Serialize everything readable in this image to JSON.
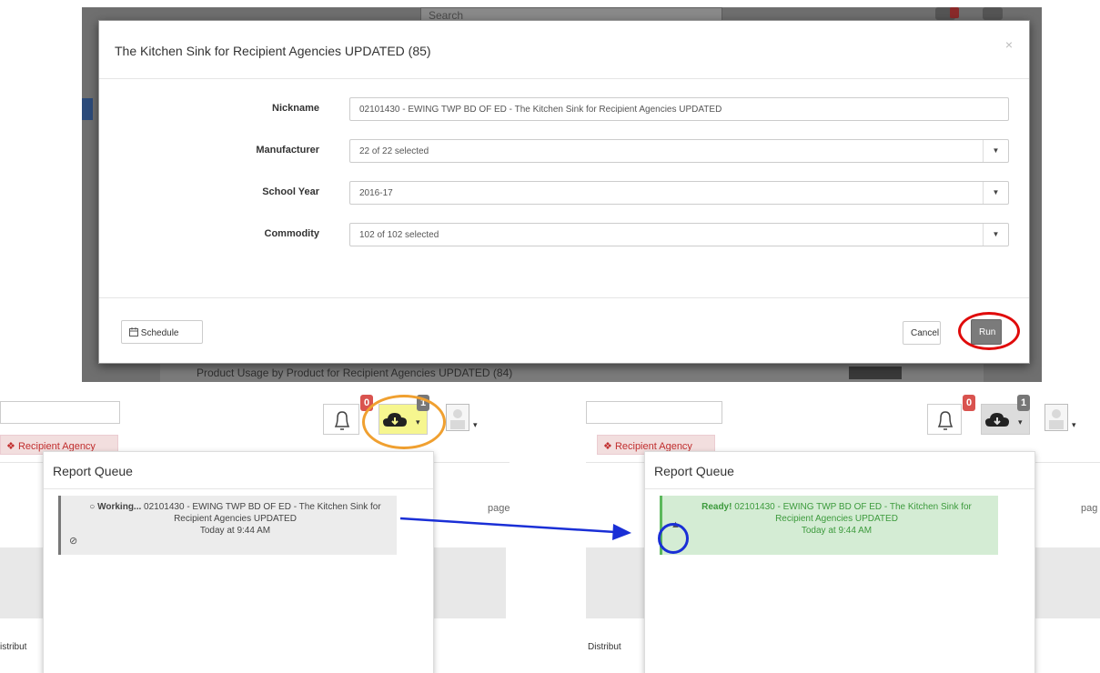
{
  "top": {
    "background": {
      "search_placeholder": "Search",
      "row_label": "Product Usage by Product for Recipient Agencies UPDATED (84)"
    },
    "modal": {
      "title": "The Kitchen Sink for Recipient Agencies UPDATED (85)",
      "close_icon": "×",
      "fields": {
        "nickname": {
          "label": "Nickname",
          "value": "02101430 - EWING TWP BD OF ED - The Kitchen Sink for Recipient Agencies UPDATED"
        },
        "manufacturer": {
          "label": "Manufacturer",
          "value": "22 of 22 selected"
        },
        "school_year": {
          "label": "School Year",
          "value": "2016-17"
        },
        "commodity": {
          "label": "Commodity",
          "value": "102 of 102 selected"
        }
      },
      "caret": "▼",
      "schedule_icon": "calendar-icon",
      "schedule_label": "Schedule",
      "cancel_label": "Cancel",
      "run_label": "Run"
    }
  },
  "left_panel": {
    "recipient_tag": "Recipient Agency",
    "notification_badge": "0",
    "download_badge": "1",
    "queue_title": "Report Queue",
    "item": {
      "status": "Working...",
      "text": "02101430 - EWING TWP BD OF ED - The Kitchen Sink for Recipient Agencies UPDATED",
      "time": "Today at 9:44 AM"
    },
    "side_text": "page",
    "bottom_text": "istribut"
  },
  "right_panel": {
    "recipient_tag": "Recipient Agency",
    "notification_badge": "0",
    "download_badge": "1",
    "queue_title": "Report Queue",
    "item": {
      "status": "Ready!",
      "text": "02101430 - EWING TWP BD OF ED - The Kitchen Sink for Recipient Agencies UPDATED",
      "time": "Today at 9:44 AM"
    },
    "side_text": "pag",
    "bottom_text": "Distribut"
  },
  "colors": {
    "highlight_red": "#e00b0b",
    "highlight_orange": "#f0a030",
    "highlight_blue": "#1a2fd6",
    "arrow_blue": "#1a2fd6",
    "ready_green": "#3c9a3c"
  }
}
